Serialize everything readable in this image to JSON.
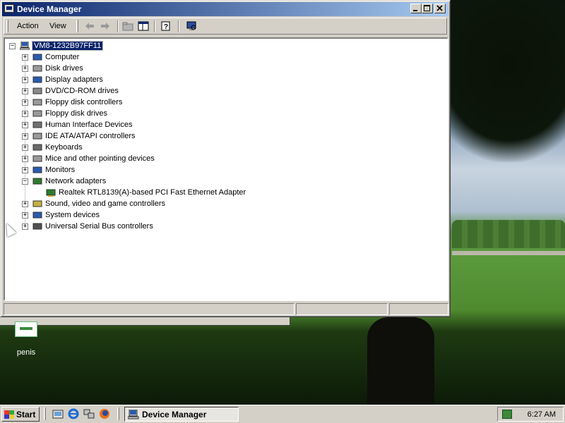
{
  "window": {
    "title": "Device Manager"
  },
  "menu": {
    "action": "Action",
    "view": "View"
  },
  "tree": {
    "root": "VM8-1232B97FF11",
    "categories": [
      "Computer",
      "Disk drives",
      "Display adapters",
      "DVD/CD-ROM drives",
      "Floppy disk controllers",
      "Floppy disk drives",
      "Human Interface Devices",
      "IDE ATA/ATAPI controllers",
      "Keyboards",
      "Mice and other pointing devices",
      "Monitors",
      "Network adapters",
      "Sound, video and game controllers",
      "System devices",
      "Universal Serial Bus controllers"
    ],
    "network_child": "Realtek RTL8139(A)-based PCI Fast Ethernet Adapter"
  },
  "desktop": {
    "icon_label": "penis"
  },
  "taskbar": {
    "start_label": "Start",
    "task_label": "Device Manager",
    "clock": "6:27 AM"
  }
}
